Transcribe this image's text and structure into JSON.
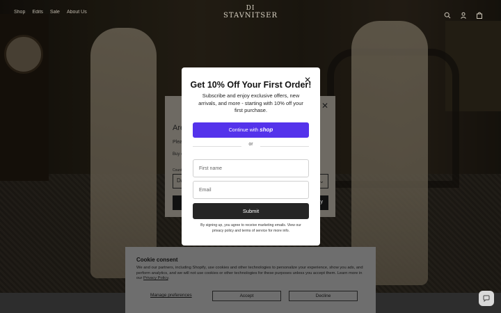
{
  "header": {
    "nav": [
      "Shop",
      "Edits",
      "Sale",
      "About Us"
    ],
    "logo_line1": "DI",
    "logo_line2": "STAVNITSER",
    "icons": [
      "search-icon",
      "account-icon",
      "cart-icon"
    ]
  },
  "locale_modal": {
    "title": "Are",
    "line1": "Plea",
    "line2": "Buy orde",
    "select_label": "Count",
    "select_value": "Da",
    "button_label": "y"
  },
  "popup": {
    "title": "Get 10% Off Your First Order!",
    "subtitle": "Subscribe and enjoy exclusive offers, new arrivals, and more - starting with 10% off your first purchase.",
    "shop_button_prefix": "Continue with",
    "shop_button_brand": "shop",
    "divider": "or",
    "first_name_placeholder": "First name",
    "email_placeholder": "Email",
    "submit_label": "Submit",
    "legal": "By signing up, you agree to receive marketing emails. View our privacy policy and terms of service for more info."
  },
  "cookie": {
    "title": "Cookie consent",
    "text": "We and our partners, including Shopify, use cookies and other technologies to personalize your experience, show you ads, and perform analytics, and we will not use cookies or other technologies for these purposes unless you accept them. Learn more in our",
    "link": "Privacy Policy",
    "manage": "Manage preferences",
    "accept": "Accept",
    "decline": "Decline"
  },
  "colors": {
    "shop_button": "#5433eb",
    "submit_button": "#262626"
  }
}
